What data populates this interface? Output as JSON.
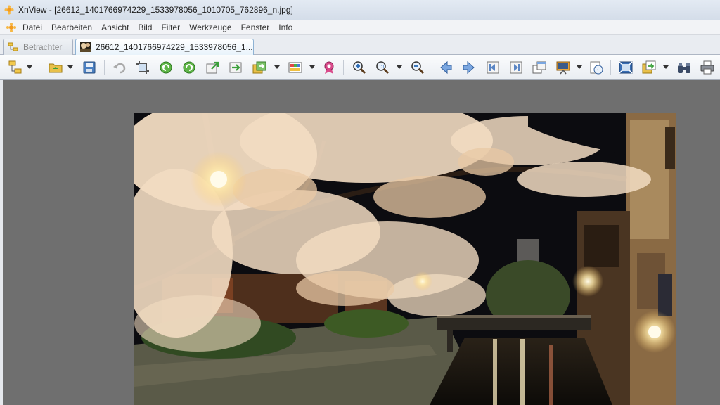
{
  "window": {
    "title": "XnView - [26612_1401766974229_1533978056_1010705_762896_n.jpg]"
  },
  "menu": {
    "items": [
      "Datei",
      "Bearbeiten",
      "Ansicht",
      "Bild",
      "Filter",
      "Werkzeuge",
      "Fenster",
      "Info"
    ]
  },
  "tabs": {
    "browser": "Betrachter",
    "image": "26612_1401766974229_1533978056_1..."
  },
  "toolbar": {
    "icons": [
      "browser-icon",
      "open-folder-icon",
      "save-icon",
      "undo-icon",
      "crop-icon",
      "rotate-left-icon",
      "rotate-right-icon",
      "export-icon",
      "import-icon",
      "batch-icon",
      "color-adjust-icon",
      "effects-icon",
      "zoom-in-icon",
      "zoom-fit-icon",
      "zoom-out-icon",
      "previous-icon",
      "next-icon",
      "first-icon",
      "last-icon",
      "windows-icon",
      "slideshow-icon",
      "properties-icon",
      "fullscreen-icon",
      "wallpaper-icon",
      "find-icon",
      "print-icon"
    ]
  },
  "colors": {
    "viewer_background": "#6f6f6f",
    "active_tab_border": "#8fb3d4"
  }
}
